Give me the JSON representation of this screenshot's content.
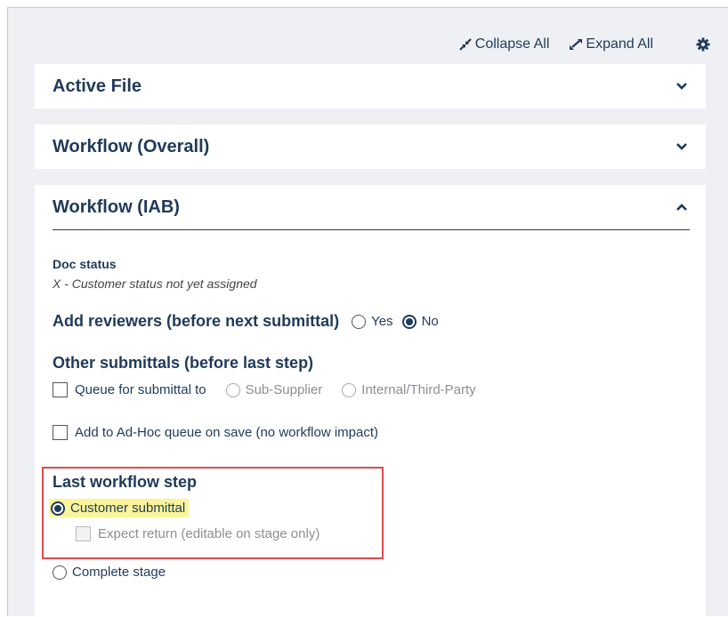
{
  "toolbar": {
    "collapse_label": "Collapse All",
    "expand_label": "Expand All"
  },
  "panels": {
    "active_file": "Active File",
    "workflow_overall": "Workflow (Overall)",
    "workflow_iab": "Workflow (IAB)"
  },
  "iab": {
    "doc_status_label": "Doc status",
    "doc_status_value": "X - Customer status not yet assigned",
    "add_reviewers": {
      "label": "Add reviewers (before next submittal)",
      "options": [
        "Yes",
        "No"
      ],
      "selected": "No"
    },
    "other_submittals": {
      "heading": "Other submittals (before last step)",
      "queue_label": "Queue for submittal to",
      "queue_options": [
        "Sub-Supplier",
        "Internal/Third-Party"
      ],
      "adhoc_label": "Add to Ad-Hoc queue on save (no workflow impact)"
    },
    "last_step": {
      "heading": "Last workflow step",
      "customer_submittal": "Customer submittal",
      "expect_return": "Expect return (editable on stage only)",
      "complete_stage": "Complete stage",
      "selected": "Customer submittal"
    }
  },
  "colors": {
    "primary": "#1f3a5a",
    "highlight_border": "#e0494f",
    "highlight_fill": "#fbf59a",
    "panel_bg": "#eef0f3"
  }
}
